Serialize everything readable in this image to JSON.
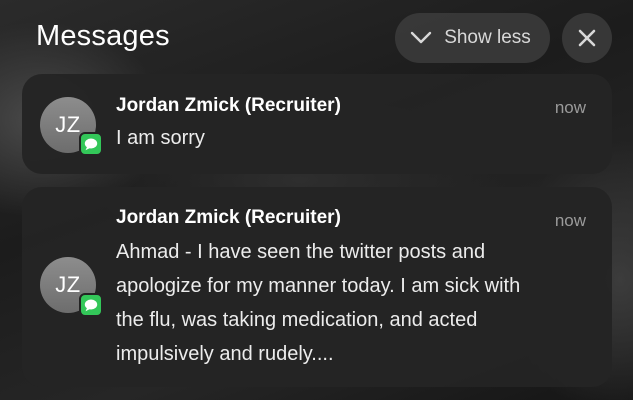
{
  "header": {
    "title": "Messages",
    "show_less_label": "Show less"
  },
  "notifications": [
    {
      "initials": "JZ",
      "sender": "Jordan Zmick (Recruiter)",
      "time": "now",
      "lines": [
        "I am sorry"
      ],
      "app_icon": "messages-app-icon"
    },
    {
      "initials": "JZ",
      "sender": "Jordan Zmick (Recruiter)",
      "time": "now",
      "lines": [
        "Ahmad - I have seen the twitter posts and",
        "apologize for my manner today. I am sick with",
        "the flu, was taking medication, and acted",
        "impulsively and rudely...."
      ],
      "app_icon": "messages-app-icon"
    }
  ],
  "colors": {
    "badge_green": "#33c759",
    "timestamp_gray": "#9a9a9a",
    "card_bg": "#242424"
  }
}
